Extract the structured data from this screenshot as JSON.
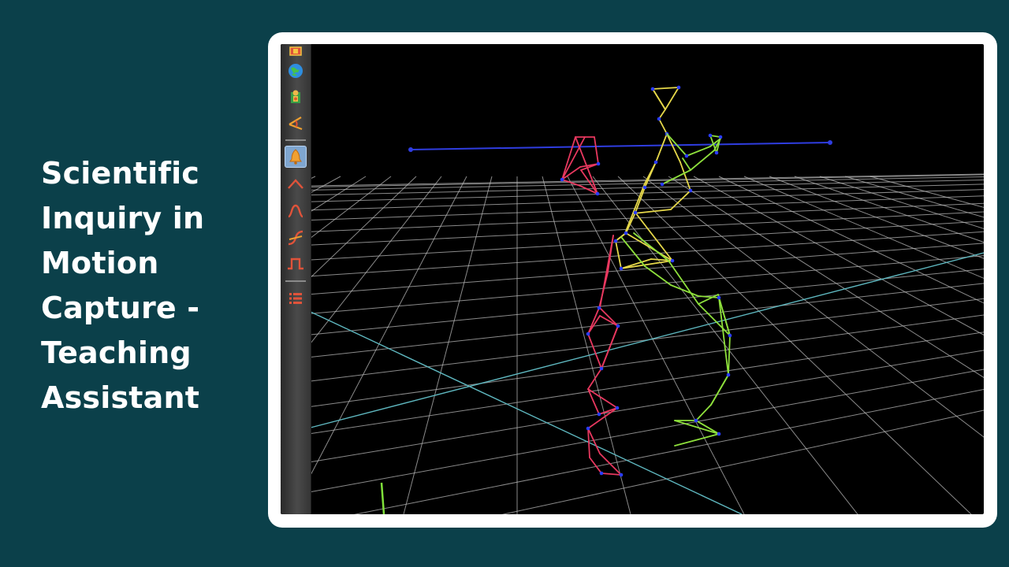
{
  "slide": {
    "title_lines": [
      "Scientific",
      "Inquiry in",
      "Motion",
      "Capture -",
      "Teaching",
      "Assistant"
    ]
  },
  "colors": {
    "background": "#0b404a",
    "frame": "#ffffff",
    "viewport": "#000000",
    "grid": "#b8b8b8",
    "grid_axis": "#5fb8c0",
    "axis_blue": "#2f3de0",
    "axis_green": "#7fe03a",
    "skeleton_right": "#e8385f",
    "skeleton_left": "#8ee03c",
    "skeleton_center": "#e6d84a",
    "marker": "#2a3cff"
  },
  "toolbar": {
    "tools": [
      {
        "name": "color-cube-icon",
        "active": false
      },
      {
        "name": "globe-icon",
        "active": false
      },
      {
        "name": "figure-body-icon",
        "active": false
      },
      {
        "name": "angle-icon",
        "active": false
      },
      {
        "name": "bell-icon",
        "active": true
      },
      {
        "name": "caret-up-curve-icon",
        "active": false
      },
      {
        "name": "bump-curve-icon",
        "active": false
      },
      {
        "name": "s-curve-icon",
        "active": false
      },
      {
        "name": "square-wave-icon",
        "active": false
      },
      {
        "name": "list-icon",
        "active": false
      }
    ]
  }
}
